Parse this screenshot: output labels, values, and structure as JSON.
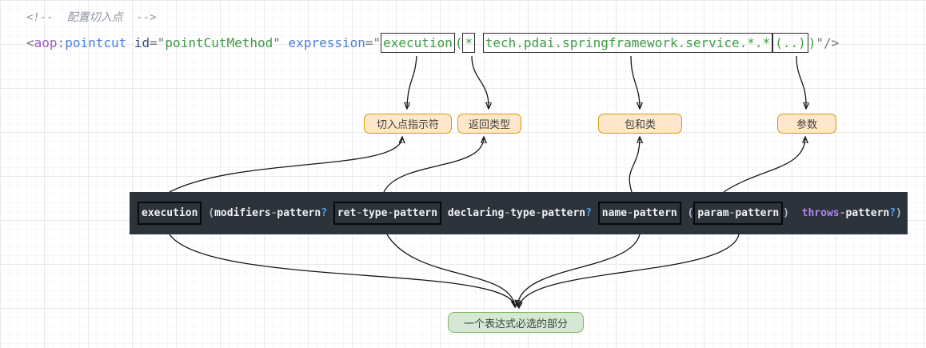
{
  "colors": {
    "canvas_bg": "#ffffff",
    "grid_major": "#e9e9e9",
    "grid_minor": "#f6f6f6",
    "callout_fill": "#ffe6cc",
    "callout_border": "#d79b00",
    "note_fill": "#d5e8d4",
    "note_border": "#82b366",
    "bar_bg": "#2d333b",
    "bar_text": "#f0f3f6",
    "bar_question_mark": "#539bf5",
    "bar_throws": "#b083f0",
    "xml_string_green": "#3f9b45",
    "xml_tag_purple": "#a259c4",
    "xml_attr_blue": "#4a7fd6",
    "arrow_stroke": "#161616"
  },
  "comment": {
    "text": "<!--  配置切入点  -->"
  },
  "xml_line": {
    "tokens": [
      {
        "t": "<",
        "s": "gray"
      },
      {
        "t": "aop",
        "s": "purple"
      },
      {
        "t": ":",
        "s": "gray"
      },
      {
        "t": "pointcut",
        "s": "blue"
      },
      {
        "t": " ",
        "s": "gray"
      },
      {
        "t": "id",
        "s": "navy"
      },
      {
        "t": "=\"",
        "s": "gray"
      },
      {
        "t": "pointCutMethod",
        "s": "green"
      },
      {
        "t": "\" ",
        "s": "gray"
      },
      {
        "t": "expression",
        "s": "blue"
      },
      {
        "t": "=\"",
        "s": "gray"
      },
      {
        "box": true,
        "parts": [
          {
            "t": "execution",
            "s": "green"
          }
        ]
      },
      {
        "t": "(",
        "s": "green"
      },
      {
        "box": true,
        "parts": [
          {
            "t": "*",
            "s": "green"
          }
        ]
      },
      {
        "t": " ",
        "s": "green"
      },
      {
        "box": true,
        "parts": [
          {
            "t": "tech.pdai.springframework.service.*.*",
            "s": "green"
          }
        ]
      },
      {
        "box": true,
        "parts": [
          {
            "t": "(..)",
            "s": "green"
          }
        ]
      },
      {
        "t": ")",
        "s": "green"
      },
      {
        "t": "\"/>",
        "s": "gray"
      }
    ]
  },
  "callouts": {
    "designator": "切入点指示符",
    "return_type": "返回类型",
    "package_class": "包和类",
    "params": "参数"
  },
  "pattern_bar": {
    "tokens": [
      {
        "box": true,
        "parts": [
          {
            "t": "execution",
            "s": "w"
          }
        ]
      },
      {
        "t": " (",
        "s": "p"
      },
      {
        "t": "modifiers",
        "s": "w"
      },
      {
        "t": "-",
        "s": "d"
      },
      {
        "t": "pattern",
        "s": "w"
      },
      {
        "t": "?",
        "s": "q"
      },
      {
        "t": " ",
        "s": "w"
      },
      {
        "box": true,
        "parts": [
          {
            "t": "ret",
            "s": "w"
          },
          {
            "t": "-",
            "s": "d"
          },
          {
            "t": "type",
            "s": "w"
          },
          {
            "t": "-",
            "s": "d"
          },
          {
            "t": "pattern",
            "s": "w"
          }
        ]
      },
      {
        "t": " ",
        "s": "w"
      },
      {
        "t": "declaring",
        "s": "w"
      },
      {
        "t": "-",
        "s": "d"
      },
      {
        "t": "type",
        "s": "w"
      },
      {
        "t": "-",
        "s": "d"
      },
      {
        "t": "pattern",
        "s": "w"
      },
      {
        "t": "?",
        "s": "q"
      },
      {
        "t": " ",
        "s": "w"
      },
      {
        "box": true,
        "parts": [
          {
            "t": "name",
            "s": "w"
          },
          {
            "t": "-",
            "s": "d"
          },
          {
            "t": "pattern",
            "s": "w"
          }
        ]
      },
      {
        "t": " (",
        "s": "p"
      },
      {
        "box": true,
        "parts": [
          {
            "t": "param",
            "s": "w"
          },
          {
            "t": "-",
            "s": "d"
          },
          {
            "t": "pattern",
            "s": "w"
          }
        ]
      },
      {
        "t": ")",
        "s": "p"
      },
      {
        "t": "  ",
        "s": "w"
      },
      {
        "t": "throws",
        "s": "t"
      },
      {
        "t": "-",
        "s": "d"
      },
      {
        "t": "pattern",
        "s": "w"
      },
      {
        "t": "?",
        "s": "q"
      },
      {
        "t": ")",
        "s": "p"
      }
    ]
  },
  "note": {
    "text": "一个表达式必选的部分"
  }
}
